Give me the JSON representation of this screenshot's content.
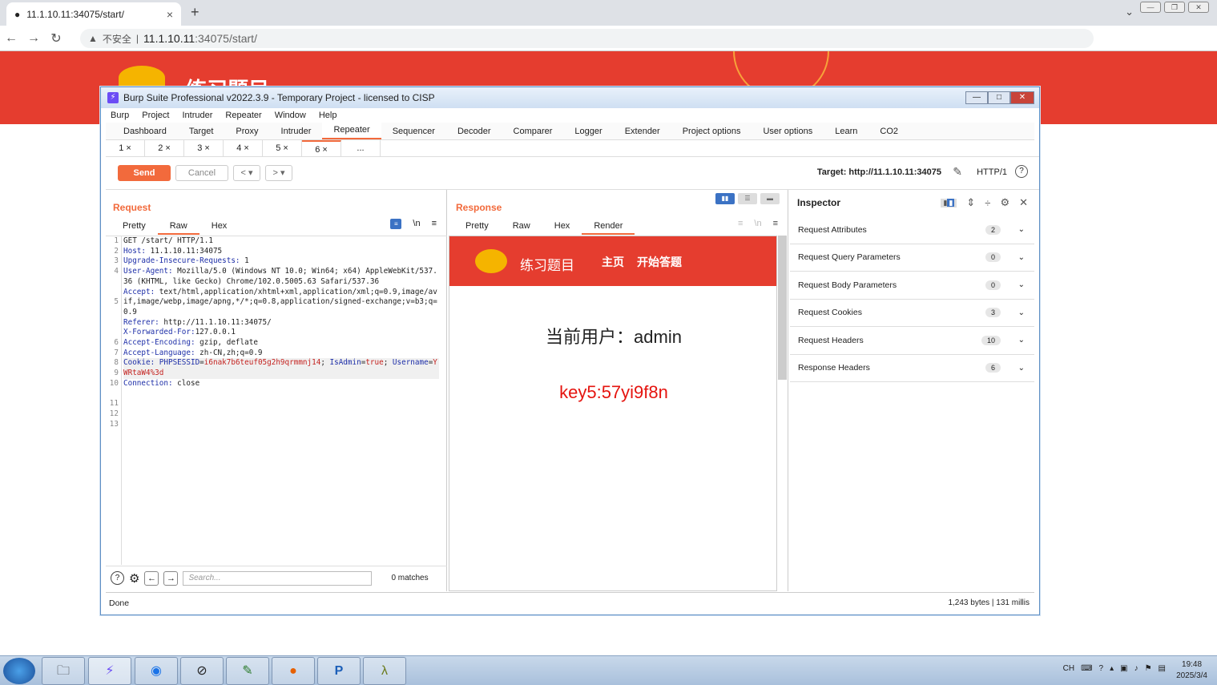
{
  "browser": {
    "tab_title": "11.1.10.11:34075/start/",
    "tab_close": "×",
    "new_tab": "+",
    "insecure_label": "不安全",
    "url_host": "11.1.10.11",
    "url_path": ":34075/start/"
  },
  "site": {
    "title": "练习题目"
  },
  "burp": {
    "title": "Burp Suite Professional v2022.3.9 - Temporary Project - licensed to CISP",
    "menu": [
      "Burp",
      "Project",
      "Intruder",
      "Repeater",
      "Window",
      "Help"
    ],
    "tabs": [
      "Dashboard",
      "Target",
      "Proxy",
      "Intruder",
      "Repeater",
      "Sequencer",
      "Decoder",
      "Comparer",
      "Logger",
      "Extender",
      "Project options",
      "User options",
      "Learn",
      "CO2"
    ],
    "active_tab": "Repeater",
    "subtabs": [
      "1 ×",
      "2 ×",
      "3 ×",
      "4 ×",
      "5 ×",
      "6 ×",
      "..."
    ],
    "send_label": "Send",
    "cancel_label": "Cancel",
    "target_label": "Target: http://11.1.10.11:34075",
    "http_version": "HTTP/1",
    "request": {
      "title": "Request",
      "tabs": [
        "Pretty",
        "Raw",
        "Hex"
      ],
      "active_tab": "Raw",
      "newline_toggle": "\\n",
      "line_numbers": [
        "1",
        "2",
        "3",
        "4",
        "",
        "",
        "5",
        "",
        "",
        "",
        "6",
        "7",
        "8",
        "9",
        "10",
        "",
        "11",
        "12",
        "13"
      ],
      "search_placeholder": "Search...",
      "matches": "0 matches"
    },
    "response": {
      "title": "Response",
      "tabs": [
        "Pretty",
        "Raw",
        "Hex",
        "Render"
      ],
      "active_tab": "Render",
      "render_title": "练习题目",
      "render_nav_home": "主页",
      "render_nav_start": "开始答题",
      "render_user": "当前用户：admin",
      "render_key": "key5:57yi9f8n"
    },
    "inspector": {
      "title": "Inspector",
      "rows": [
        {
          "label": "Request Attributes",
          "count": "2"
        },
        {
          "label": "Request Query Parameters",
          "count": "0"
        },
        {
          "label": "Request Body Parameters",
          "count": "0"
        },
        {
          "label": "Request Cookies",
          "count": "3"
        },
        {
          "label": "Request Headers",
          "count": "10"
        },
        {
          "label": "Response Headers",
          "count": "6"
        }
      ]
    },
    "status_left": "Done",
    "status_right": "1,243 bytes | 131 millis"
  },
  "taskbar": {
    "lang": "CH",
    "time": "19:48",
    "date": "2025/3/4"
  }
}
